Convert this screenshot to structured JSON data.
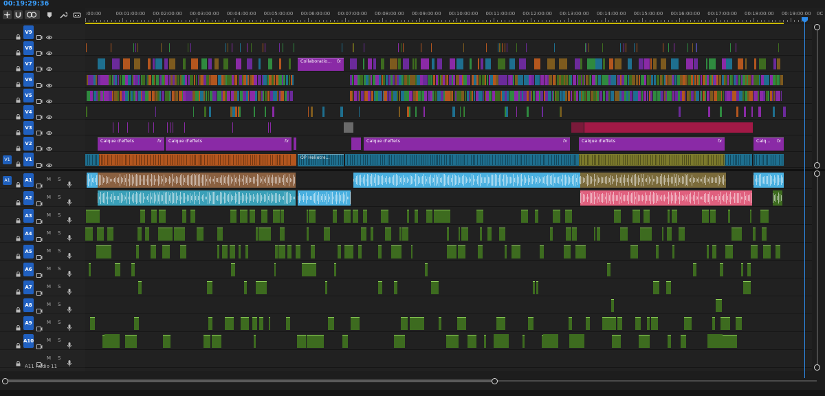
{
  "timecode": "00:19:29:36",
  "ruler": {
    "labels": [
      ":00:00",
      "00:01:00:00",
      "00:02:00:00",
      "00:03:00:00",
      "00:04:00:00",
      "00:05:00:00",
      "00:06:00:00",
      "00:07:00:00",
      "00:08:00:00",
      "00:09:00:00",
      "00:10:00:00",
      "00:11:00:00",
      "00:12:00:00",
      "00:13:00:00",
      "00:14:00:00",
      "00:15:00:00",
      "00:16:00:00",
      "00:17:00:00",
      "00:18:00:00",
      "00:19:00:00",
      "0C"
    ]
  },
  "toolbar": {
    "tools": [
      "insert-sequence-icon",
      "snap-icon",
      "linked-selection-icon",
      "marker-icon",
      "wrench-icon",
      "captions-icon"
    ]
  },
  "video_tracks": [
    {
      "name": "V9",
      "source": ""
    },
    {
      "name": "V8",
      "source": ""
    },
    {
      "name": "V7",
      "source": ""
    },
    {
      "name": "V6",
      "source": ""
    },
    {
      "name": "V5",
      "source": ""
    },
    {
      "name": "V4",
      "source": ""
    },
    {
      "name": "V3",
      "source": ""
    },
    {
      "name": "V2",
      "source": ""
    },
    {
      "name": "V1",
      "source": "V1"
    }
  ],
  "audio_tracks": [
    {
      "name": "A1",
      "source": "A1"
    },
    {
      "name": "A2",
      "source": ""
    },
    {
      "name": "A3",
      "source": ""
    },
    {
      "name": "A4",
      "source": ""
    },
    {
      "name": "A5",
      "source": ""
    },
    {
      "name": "A6",
      "source": ""
    },
    {
      "name": "A7",
      "source": ""
    },
    {
      "name": "A8",
      "source": ""
    },
    {
      "name": "A9",
      "source": ""
    },
    {
      "name": "A10",
      "source": ""
    },
    {
      "name": "",
      "source": ""
    }
  ],
  "audio_controls": {
    "mute": "M",
    "solo": "S"
  },
  "extra_audio": {
    "id": "A11",
    "name": "Audio 11"
  },
  "labeled_clips": [
    {
      "track": "V7",
      "label": "Collaboratio...",
      "fx": "fx"
    },
    {
      "track": "V2",
      "label": "Calque d'effets",
      "fx": "fx"
    },
    {
      "track": "V2",
      "label": "Calque d'effets",
      "fx": "fx"
    },
    {
      "track": "V2",
      "label": "Calque d'effets",
      "fx": "fx"
    },
    {
      "track": "V2",
      "label": "Calque d'effets",
      "fx": "fx"
    },
    {
      "track": "V2",
      "label": "Calq...",
      "fx": "fx"
    },
    {
      "track": "V1",
      "label": "OP Heliotre...",
      "fx": ""
    }
  ],
  "colors": {
    "accent": "#2d8ceb",
    "timecode": "#3aa0ff",
    "work_area": "#c9b800",
    "adjustment_layer": "#8a2aa6",
    "v1_orange": "#b3561e",
    "v1_teal": "#1e6f8f",
    "v1_olive": "#7c7a2c",
    "audio_blue": "#4ab0e0",
    "audio_pink": "#e0607e",
    "audio_green": "#3d6b1f",
    "v3_crimson": "#b0184a"
  }
}
